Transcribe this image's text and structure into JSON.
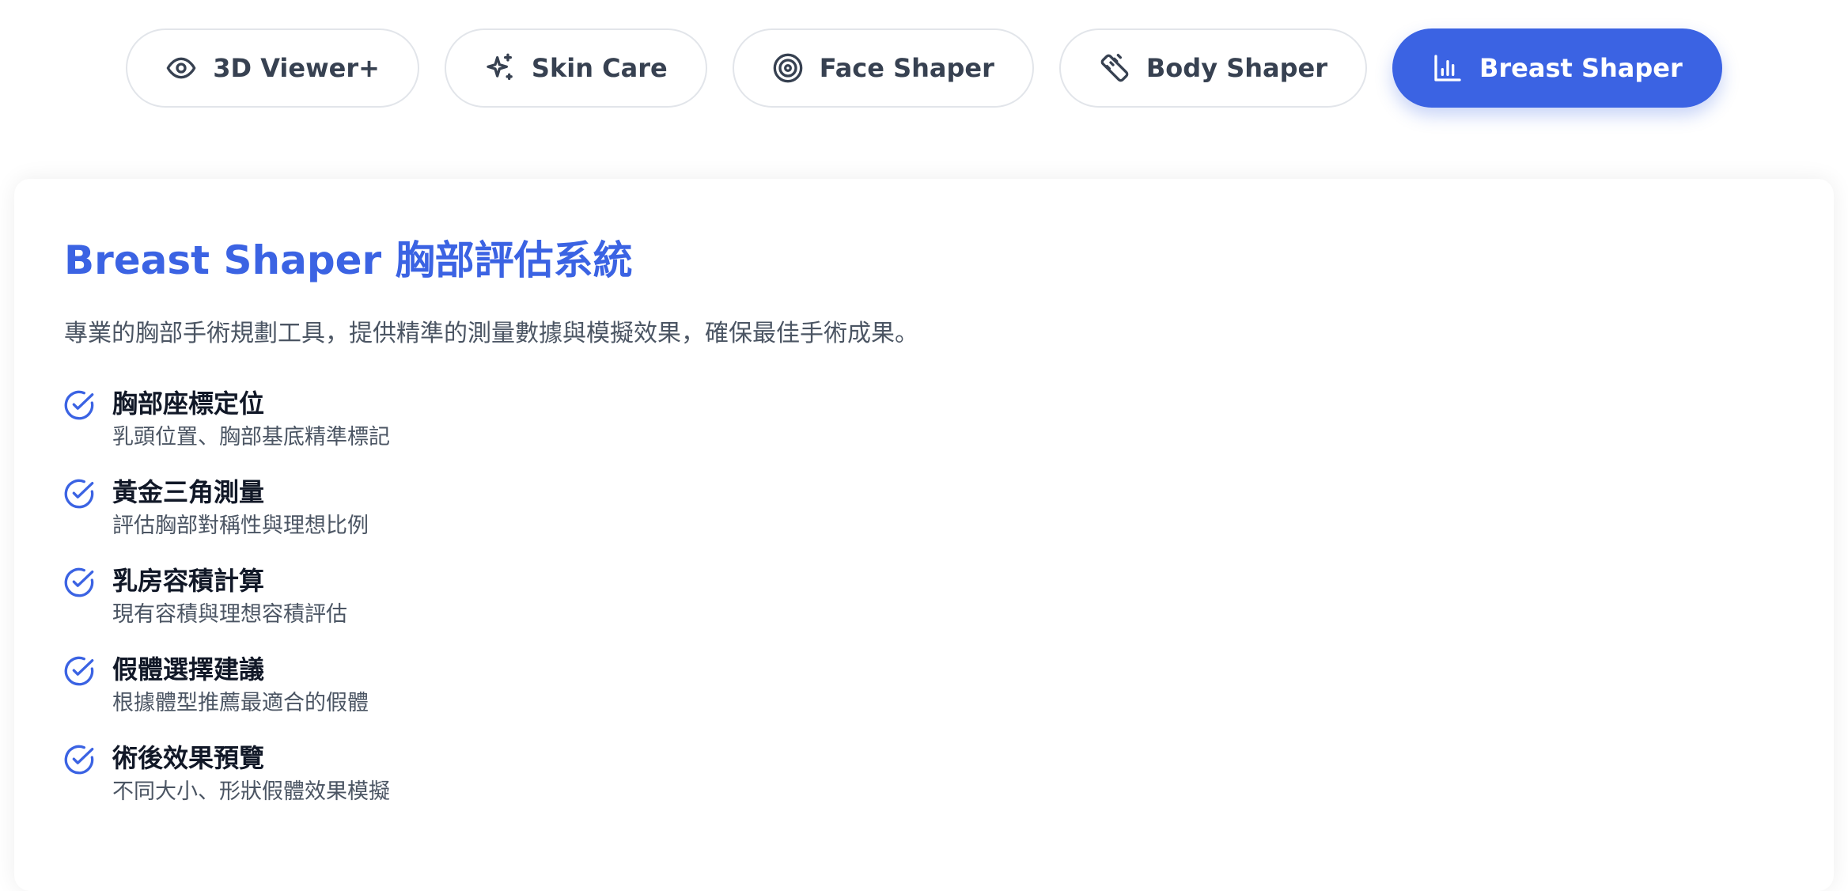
{
  "tabs": [
    {
      "label": "3D Viewer+",
      "icon": "eye-icon",
      "active": false
    },
    {
      "label": "Skin Care",
      "icon": "sparkles-icon",
      "active": false
    },
    {
      "label": "Face Shaper",
      "icon": "target-icon",
      "active": false
    },
    {
      "label": "Body Shaper",
      "icon": "ruler-icon",
      "active": false
    },
    {
      "label": "Breast Shaper",
      "icon": "bar-chart-icon",
      "active": true
    }
  ],
  "content": {
    "title": "Breast Shaper 胸部評估系統",
    "description": "專業的胸部手術規劃工具，提供精準的測量數據與模擬效果，確保最佳手術成果。",
    "features": [
      {
        "title": "胸部座標定位",
        "subtitle": "乳頭位置、胸部基底精準標記"
      },
      {
        "title": "黃金三角測量",
        "subtitle": "評估胸部對稱性與理想比例"
      },
      {
        "title": "乳房容積計算",
        "subtitle": "現有容積與理想容積評估"
      },
      {
        "title": "假體選擇建議",
        "subtitle": "根據體型推薦最適合的假體"
      },
      {
        "title": "術後效果預覽",
        "subtitle": "不同大小、形狀假體效果模擬"
      }
    ]
  },
  "colors": {
    "accent": "#3b63e3",
    "tab_border": "#e2e5ea",
    "text_dark": "#111827",
    "text_muted": "#4b5563"
  }
}
